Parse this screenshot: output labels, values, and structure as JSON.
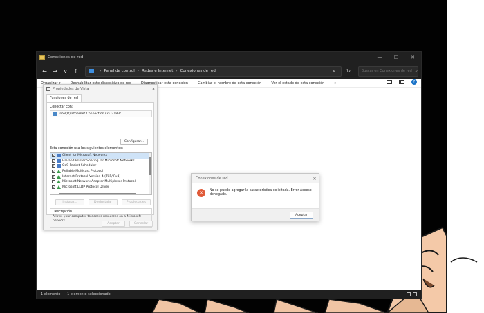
{
  "explorer": {
    "title": "Conexiones de red",
    "window_buttons": {
      "minimize": "—",
      "maximize": "☐",
      "close": "✕"
    },
    "nav": {
      "back": "←",
      "forward": "→",
      "recent": "∨",
      "up": "↑"
    },
    "breadcrumb": [
      "Panel de control",
      "Redes e Internet",
      "Conexiones de red"
    ],
    "search_placeholder": "Buscar en Conexiones de red",
    "commands": [
      "Organizar ▾",
      "Deshabilitar este dispositivo de red",
      "Diagnosticar esta conexión",
      "Cambiar el nombre de esta conexión",
      "Ver el estado de esta conexión",
      "»"
    ],
    "status": {
      "items": "1 elemento",
      "selected": "1 elemento seleccionado"
    }
  },
  "properties": {
    "title": "Propiedades de Vista",
    "tab": "Funciones de red",
    "connect_label": "Conectar con:",
    "adapter": "Intel(R) Ethernet Connection (2) I218-V",
    "configure_button": "Configurar...",
    "elements_label": "Esta conexión usa los siguientes elementos:",
    "items": [
      {
        "label": "Client for Microsoft Networks",
        "checked": true,
        "icon": "net"
      },
      {
        "label": "File and Printer Sharing for Microsoft Networks",
        "checked": true,
        "icon": "net"
      },
      {
        "label": "QoS Packet Scheduler",
        "checked": true,
        "icon": "net"
      },
      {
        "label": "Reliable Multicast Protocol",
        "checked": true,
        "icon": "proto"
      },
      {
        "label": "Internet Protocol Version 4 (TCP/IPv4)",
        "checked": true,
        "icon": "proto"
      },
      {
        "label": "Microsoft Network Adapter Multiplexor Protocol",
        "checked": false,
        "icon": "proto"
      },
      {
        "label": "Microsoft LLDP Protocol Driver",
        "checked": true,
        "icon": "proto"
      }
    ],
    "install_button": "Instalar...",
    "uninstall_button": "Desinstalar",
    "properties_button": "Propiedades",
    "description_title": "Descripción",
    "description_text": "Allows your computer to access resources on a Microsoft network.",
    "ok_button": "Aceptar",
    "cancel_button": "Cancelar"
  },
  "error_dialog": {
    "title": "Conexiones de red",
    "message": "No se puede agregar la característica solicitada. Error Acceso denegado.",
    "ok_button": "Aceptar",
    "icon_glyph": "✕"
  },
  "colors": {
    "titlebar": "#202020",
    "error_icon": "#e05a38",
    "selection": "#cfe3f7",
    "accent": "#1a73c8"
  }
}
